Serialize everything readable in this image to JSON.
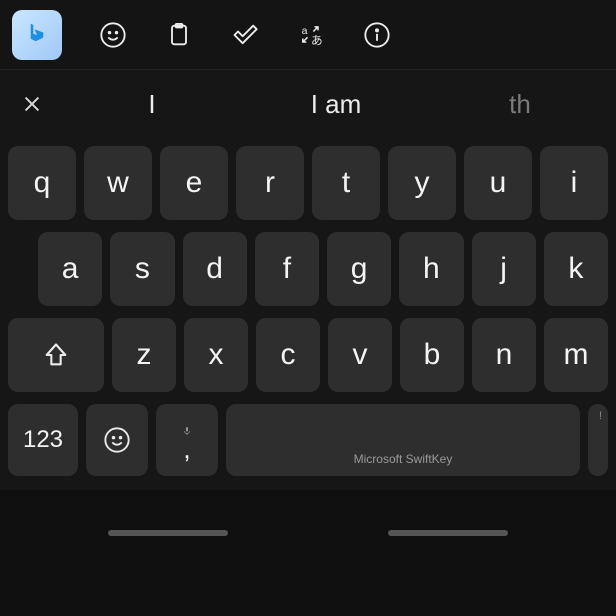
{
  "toolbar": {
    "bing": "bing",
    "emoji": "emoji",
    "clipboard": "clipboard",
    "check": "check",
    "translate": "translate",
    "info": "info"
  },
  "suggestions": {
    "close": "×",
    "s1": "I",
    "s2": "I am",
    "s3": "th"
  },
  "keys": {
    "row1": {
      "k0": "q",
      "k1": "w",
      "k2": "e",
      "k3": "r",
      "k4": "t",
      "k5": "y",
      "k6": "u",
      "k7": "i"
    },
    "row2": {
      "k0": "a",
      "k1": "s",
      "k2": "d",
      "k3": "f",
      "k4": "g",
      "k5": "h",
      "k6": "j",
      "k7": "k"
    },
    "row3": {
      "shift": "shift",
      "k0": "z",
      "k1": "x",
      "k2": "c",
      "k3": "v",
      "k4": "b",
      "k5": "n",
      "k6": "m"
    }
  },
  "bottom": {
    "numbers": "123",
    "emoji": "emoji",
    "comma": ",",
    "mic": "mic",
    "space": "Microsoft SwiftKey",
    "excl_hint": "!"
  }
}
